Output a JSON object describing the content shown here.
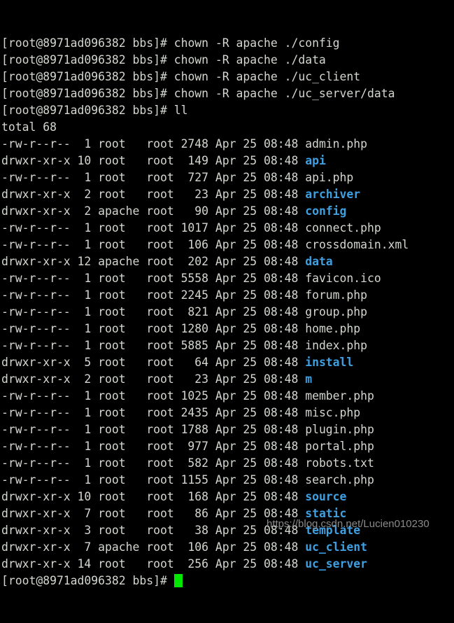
{
  "terminal": {
    "hostname_prompt": "[root@8971ad096382 bbs]# ",
    "colors": {
      "background": "#000000",
      "foreground": "#d3d7cf",
      "directory": "#3f9fe0",
      "cursor": "#00e800",
      "watermark": "#8a8a8a"
    },
    "commands": [
      "chown -R apache ./config",
      "chown -R apache ./data",
      "chown -R apache ./uc_client",
      "chown -R apache ./uc_server/data",
      "ll"
    ],
    "total_line": "total 68",
    "listing_columns": [
      "permissions",
      "links",
      "owner",
      "group",
      "size",
      "month",
      "day",
      "time",
      "name"
    ],
    "listing": [
      {
        "permissions": "-rw-r--r--",
        "links": "1",
        "owner": "root",
        "group": "root",
        "size": "2748",
        "month": "Apr",
        "day": "25",
        "time": "08:48",
        "name": "admin.php",
        "type": "file"
      },
      {
        "permissions": "drwxr-xr-x",
        "links": "10",
        "owner": "root",
        "group": "root",
        "size": "149",
        "month": "Apr",
        "day": "25",
        "time": "08:48",
        "name": "api",
        "type": "dir"
      },
      {
        "permissions": "-rw-r--r--",
        "links": "1",
        "owner": "root",
        "group": "root",
        "size": "727",
        "month": "Apr",
        "day": "25",
        "time": "08:48",
        "name": "api.php",
        "type": "file"
      },
      {
        "permissions": "drwxr-xr-x",
        "links": "2",
        "owner": "root",
        "group": "root",
        "size": "23",
        "month": "Apr",
        "day": "25",
        "time": "08:48",
        "name": "archiver",
        "type": "dir"
      },
      {
        "permissions": "drwxr-xr-x",
        "links": "2",
        "owner": "apache",
        "group": "root",
        "size": "90",
        "month": "Apr",
        "day": "25",
        "time": "08:48",
        "name": "config",
        "type": "dir"
      },
      {
        "permissions": "-rw-r--r--",
        "links": "1",
        "owner": "root",
        "group": "root",
        "size": "1017",
        "month": "Apr",
        "day": "25",
        "time": "08:48",
        "name": "connect.php",
        "type": "file"
      },
      {
        "permissions": "-rw-r--r--",
        "links": "1",
        "owner": "root",
        "group": "root",
        "size": "106",
        "month": "Apr",
        "day": "25",
        "time": "08:48",
        "name": "crossdomain.xml",
        "type": "file"
      },
      {
        "permissions": "drwxr-xr-x",
        "links": "12",
        "owner": "apache",
        "group": "root",
        "size": "202",
        "month": "Apr",
        "day": "25",
        "time": "08:48",
        "name": "data",
        "type": "dir"
      },
      {
        "permissions": "-rw-r--r--",
        "links": "1",
        "owner": "root",
        "group": "root",
        "size": "5558",
        "month": "Apr",
        "day": "25",
        "time": "08:48",
        "name": "favicon.ico",
        "type": "file"
      },
      {
        "permissions": "-rw-r--r--",
        "links": "1",
        "owner": "root",
        "group": "root",
        "size": "2245",
        "month": "Apr",
        "day": "25",
        "time": "08:48",
        "name": "forum.php",
        "type": "file"
      },
      {
        "permissions": "-rw-r--r--",
        "links": "1",
        "owner": "root",
        "group": "root",
        "size": "821",
        "month": "Apr",
        "day": "25",
        "time": "08:48",
        "name": "group.php",
        "type": "file"
      },
      {
        "permissions": "-rw-r--r--",
        "links": "1",
        "owner": "root",
        "group": "root",
        "size": "1280",
        "month": "Apr",
        "day": "25",
        "time": "08:48",
        "name": "home.php",
        "type": "file"
      },
      {
        "permissions": "-rw-r--r--",
        "links": "1",
        "owner": "root",
        "group": "root",
        "size": "5885",
        "month": "Apr",
        "day": "25",
        "time": "08:48",
        "name": "index.php",
        "type": "file"
      },
      {
        "permissions": "drwxr-xr-x",
        "links": "5",
        "owner": "root",
        "group": "root",
        "size": "64",
        "month": "Apr",
        "day": "25",
        "time": "08:48",
        "name": "install",
        "type": "dir"
      },
      {
        "permissions": "drwxr-xr-x",
        "links": "2",
        "owner": "root",
        "group": "root",
        "size": "23",
        "month": "Apr",
        "day": "25",
        "time": "08:48",
        "name": "m",
        "type": "dir"
      },
      {
        "permissions": "-rw-r--r--",
        "links": "1",
        "owner": "root",
        "group": "root",
        "size": "1025",
        "month": "Apr",
        "day": "25",
        "time": "08:48",
        "name": "member.php",
        "type": "file"
      },
      {
        "permissions": "-rw-r--r--",
        "links": "1",
        "owner": "root",
        "group": "root",
        "size": "2435",
        "month": "Apr",
        "day": "25",
        "time": "08:48",
        "name": "misc.php",
        "type": "file"
      },
      {
        "permissions": "-rw-r--r--",
        "links": "1",
        "owner": "root",
        "group": "root",
        "size": "1788",
        "month": "Apr",
        "day": "25",
        "time": "08:48",
        "name": "plugin.php",
        "type": "file"
      },
      {
        "permissions": "-rw-r--r--",
        "links": "1",
        "owner": "root",
        "group": "root",
        "size": "977",
        "month": "Apr",
        "day": "25",
        "time": "08:48",
        "name": "portal.php",
        "type": "file"
      },
      {
        "permissions": "-rw-r--r--",
        "links": "1",
        "owner": "root",
        "group": "root",
        "size": "582",
        "month": "Apr",
        "day": "25",
        "time": "08:48",
        "name": "robots.txt",
        "type": "file"
      },
      {
        "permissions": "-rw-r--r--",
        "links": "1",
        "owner": "root",
        "group": "root",
        "size": "1155",
        "month": "Apr",
        "day": "25",
        "time": "08:48",
        "name": "search.php",
        "type": "file"
      },
      {
        "permissions": "drwxr-xr-x",
        "links": "10",
        "owner": "root",
        "group": "root",
        "size": "168",
        "month": "Apr",
        "day": "25",
        "time": "08:48",
        "name": "source",
        "type": "dir"
      },
      {
        "permissions": "drwxr-xr-x",
        "links": "7",
        "owner": "root",
        "group": "root",
        "size": "86",
        "month": "Apr",
        "day": "25",
        "time": "08:48",
        "name": "static",
        "type": "dir"
      },
      {
        "permissions": "drwxr-xr-x",
        "links": "3",
        "owner": "root",
        "group": "root",
        "size": "38",
        "month": "Apr",
        "day": "25",
        "time": "08:48",
        "name": "template",
        "type": "dir"
      },
      {
        "permissions": "drwxr-xr-x",
        "links": "7",
        "owner": "apache",
        "group": "root",
        "size": "106",
        "month": "Apr",
        "day": "25",
        "time": "08:48",
        "name": "uc_client",
        "type": "dir"
      },
      {
        "permissions": "drwxr-xr-x",
        "links": "14",
        "owner": "root",
        "group": "root",
        "size": "256",
        "month": "Apr",
        "day": "25",
        "time": "08:48",
        "name": "uc_server",
        "type": "dir"
      }
    ]
  },
  "watermark": {
    "text": "https://blog.csdn.net/Lucien010230"
  }
}
